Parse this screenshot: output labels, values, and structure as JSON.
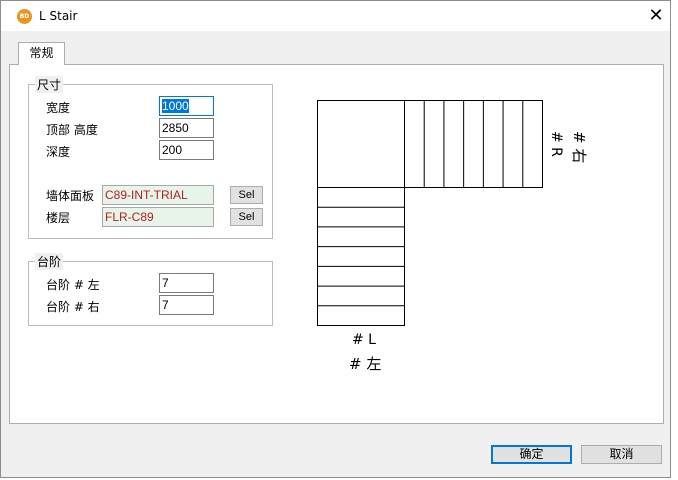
{
  "window": {
    "title": "L Stair",
    "icon_text": "BD",
    "close_glyph": "✕"
  },
  "tabs": [
    {
      "label": "常规"
    }
  ],
  "size_group": {
    "title": "尺寸",
    "width": {
      "label": "宽度",
      "value": "1000"
    },
    "top_height": {
      "label": "顶部 高度",
      "value": "2850"
    },
    "depth": {
      "label": "深度",
      "value": "200"
    },
    "wall_panel": {
      "label": "墙体面板",
      "value": "C89-INT-TRIAL",
      "button": "Sel"
    },
    "floor": {
      "label": "楼层",
      "value": "FLR-C89",
      "button": "Sel"
    }
  },
  "steps_group": {
    "title": "台阶",
    "left_steps": {
      "label": "台阶 # 左",
      "value": "7"
    },
    "right_steps": {
      "label": "台阶 # 右",
      "value": "7"
    }
  },
  "preview": {
    "left_label_1": "# L",
    "left_label_2": "# 左",
    "right_label_1": "# R",
    "right_label_2": "# 右",
    "left_steps": 7,
    "right_steps": 7
  },
  "footer": {
    "ok_label": "确定",
    "cancel_label": "取消"
  }
}
